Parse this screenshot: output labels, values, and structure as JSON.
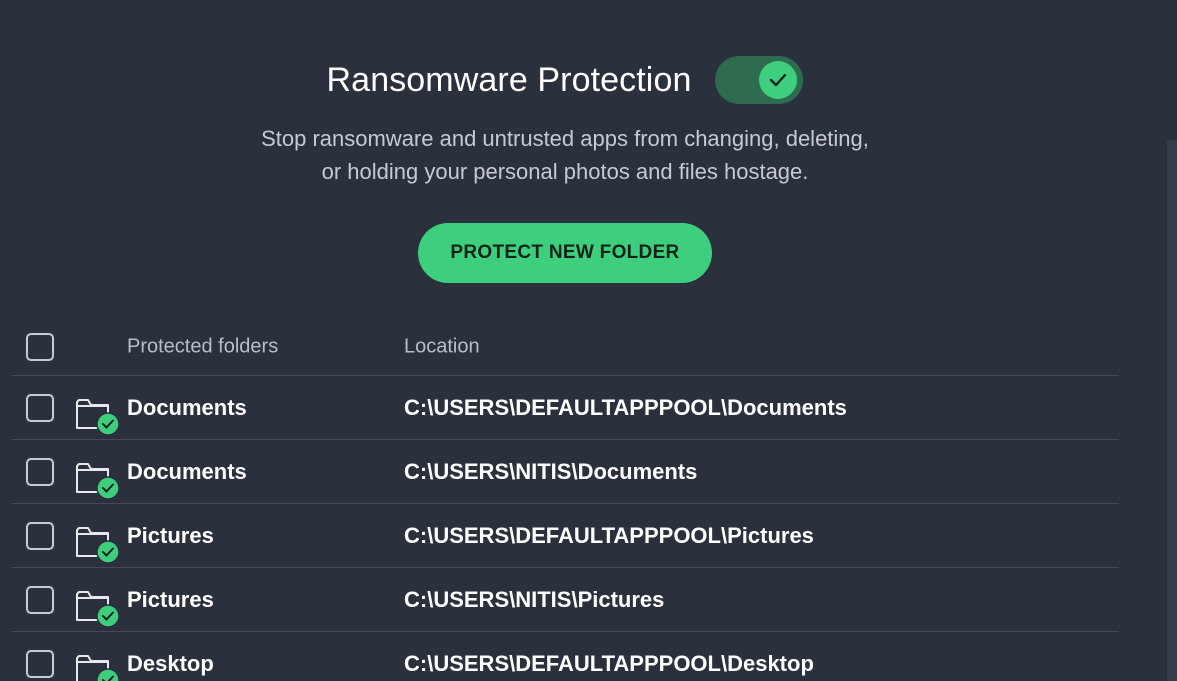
{
  "header": {
    "title": "Ransomware Protection",
    "toggle_on": true
  },
  "description": {
    "line1": "Stop ransomware and untrusted apps from changing, deleting,",
    "line2": "or holding your personal photos and files hostage."
  },
  "actions": {
    "protect_new_folder": "PROTECT NEW FOLDER"
  },
  "table": {
    "columns": {
      "name": "Protected folders",
      "location": "Location"
    },
    "rows": [
      {
        "name": "Documents",
        "location": "C:\\USERS\\DEFAULTAPPPOOL\\Documents"
      },
      {
        "name": "Documents",
        "location": "C:\\USERS\\NITIS\\Documents"
      },
      {
        "name": "Pictures",
        "location": "C:\\USERS\\DEFAULTAPPPOOL\\Pictures"
      },
      {
        "name": "Pictures",
        "location": "C:\\USERS\\NITIS\\Pictures"
      },
      {
        "name": "Desktop",
        "location": "C:\\USERS\\DEFAULTAPPPOOL\\Desktop"
      }
    ]
  },
  "icons": {
    "folder": "folder-icon",
    "protected_badge": "check-badge-icon",
    "toggle_check": "check-icon"
  },
  "colors": {
    "background": "#2a303c",
    "accent_green": "#3ecf7e",
    "toggle_track": "#2f6b4e",
    "divider": "#444b59",
    "muted_text": "#c6cad3"
  }
}
